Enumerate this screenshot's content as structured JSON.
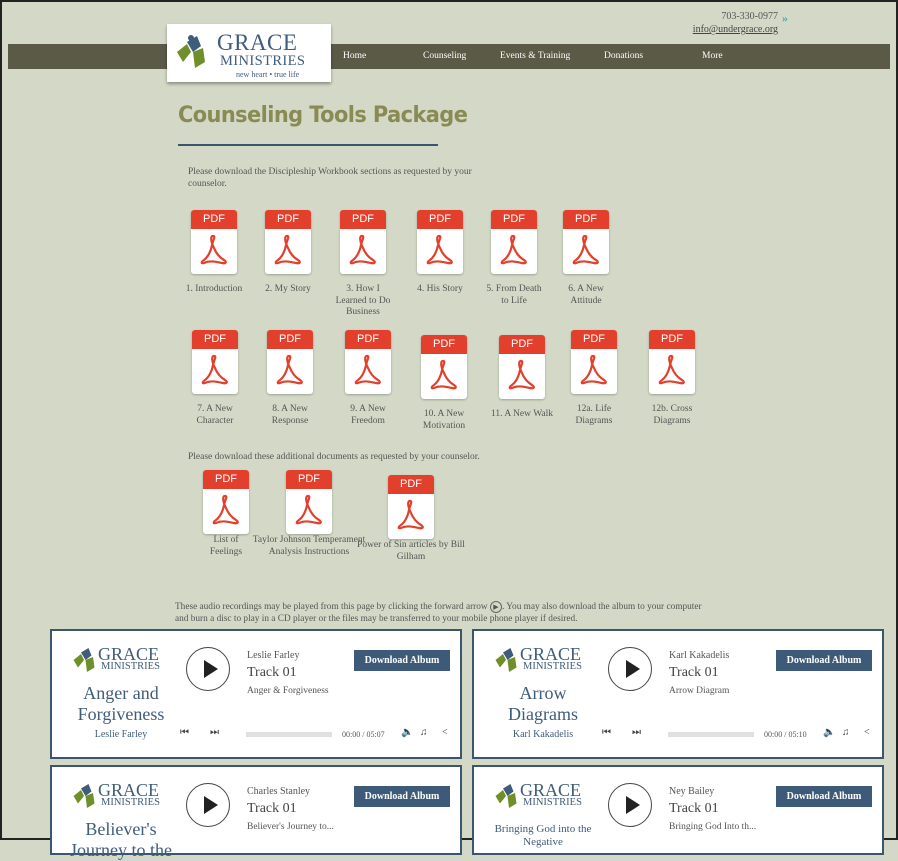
{
  "header": {
    "phone": "703-330-0977",
    "email": "info@undergrace.org",
    "logo": {
      "line1": "GRACE",
      "line2": "MINISTRIES",
      "tagline": "new heart • true life"
    },
    "nav": [
      "Home",
      "Counseling",
      "Events & Training",
      "Donations",
      "More"
    ]
  },
  "page": {
    "title": "Counseling Tools Package",
    "intro": "Please download the Discipleship Workbook sections as requested by your counselor.",
    "additional_intro": "Please download these additional documents as requested by your counselor.",
    "audio_intro": "These audio recordings may be played from this page by clicking the forward arrow",
    "audio_intro2": ". You may also download the album to your computer and burn a disc to play in a CD player or the files may be transferred to your mobile phone player if desired."
  },
  "pdf_badge": "PDF",
  "pdfs_row1": [
    "1. Introduction",
    "2. My Story",
    "3. How I Learned to Do Business",
    "4. His Story",
    "5. From Death to Life",
    "6. A New Attitude"
  ],
  "pdfs_row2": [
    "7. A New Character",
    "8. A New Response",
    "9. A New Freedom",
    "10. A New Motivation",
    "11. A New Walk",
    "12a. Life Diagrams",
    "12b. Cross Diagrams"
  ],
  "pdfs_row3": [
    "List of Feelings",
    "Taylor Johnson Temperament Analysis Instructions",
    "Power of Sin articles by Bill Gilham"
  ],
  "players": [
    {
      "art_title": "Anger and Forgiveness",
      "art_author": "Leslie Farley",
      "artist": "Leslie Farley",
      "track": "Track 01",
      "album": "Anger & Forgiveness",
      "time": "00:00 / 05:07",
      "download": "Download Album"
    },
    {
      "art_title": "Arrow Diagrams",
      "art_author": "Karl Kakadelis",
      "artist": "Karl Kakadelis",
      "track": "Track 01",
      "album": "Arrow Diagram",
      "time": "00:00 / 05:10",
      "download": "Download Album"
    },
    {
      "art_title": "Believer's Journey to the",
      "art_author": "",
      "artist": "Charles Stanley",
      "track": "Track 01",
      "album": "Believer's Journey to...",
      "time": "",
      "download": "Download Album"
    },
    {
      "art_title": "Bringing God into the Negative",
      "art_author": "",
      "artist": "Ney Bailey",
      "track": "Track 01",
      "album": "Bringing God Into th...",
      "time": "",
      "download": "Download Album"
    }
  ],
  "colors": {
    "background": "#d3d9c6",
    "nav": "#5a5a47",
    "pdf_red": "#e2402c",
    "button": "#3d5a78",
    "title": "#8a8a55"
  }
}
